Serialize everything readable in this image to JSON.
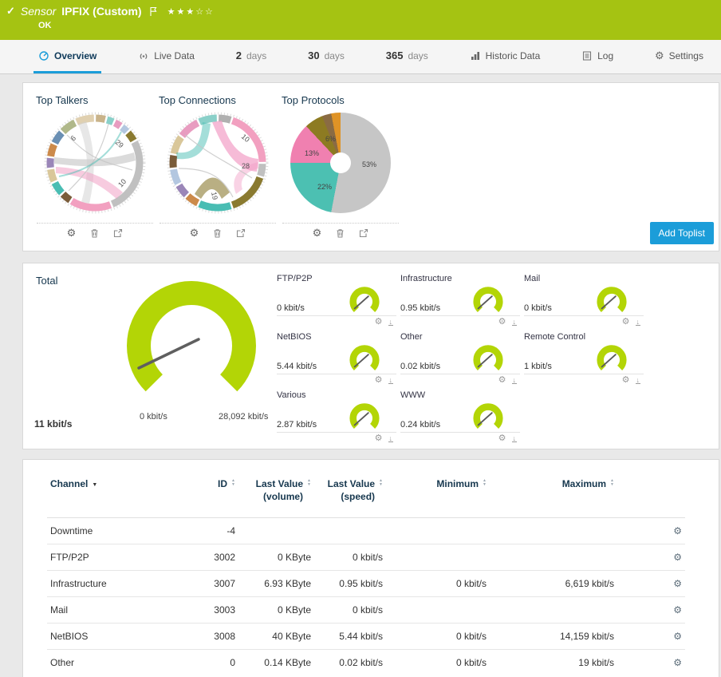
{
  "colors": {
    "header_green": "#a5c312",
    "gauge_green": "#b3d506",
    "accent_blue": "#1b9dd9",
    "header_navy": "#16374e"
  },
  "icons": {
    "check": "✓",
    "caret_down": "▼",
    "sort_up": "▲",
    "sort_down": "▼",
    "gear": "⚙",
    "download_arrow": "↓"
  },
  "header": {
    "kind_label": "Sensor",
    "sensor_name": "IPFIX (Custom)",
    "status": "OK",
    "stars": "★★★☆☆"
  },
  "tabs": [
    {
      "label": "Overview",
      "active": true
    },
    {
      "label": "Live Data"
    },
    {
      "num": "2",
      "label": "days"
    },
    {
      "num": "30",
      "label": "days"
    },
    {
      "num": "365",
      "label": "days"
    },
    {
      "label": "Historic Data"
    },
    {
      "label": "Log"
    },
    {
      "label": "Settings"
    }
  ],
  "toplists": {
    "add_button_label": "Add Toplist",
    "talkers": {
      "title": "Top Talkers",
      "segments": [
        [
          "#c9b38a",
          0.04
        ],
        [
          "#8ad0c9",
          0.03
        ],
        [
          "#e89cc0",
          0.03
        ],
        [
          "#b3c7e0",
          0.03
        ],
        [
          "#8a7a30",
          0.04
        ],
        [
          "#c0c0c0",
          0.27
        ],
        [
          "#f2a0c0",
          0.15
        ],
        [
          "#7a5c3a",
          0.04
        ],
        [
          "#49bdb3",
          0.05
        ],
        [
          "#d9c79a",
          0.05
        ],
        [
          "#9a86b8",
          0.04
        ],
        [
          "#cc8a4a",
          0.05
        ],
        [
          "#6a8fb3",
          0.05
        ],
        [
          "#b0b88a",
          0.06
        ],
        [
          "#e0d0b0",
          0.07
        ]
      ]
    },
    "connections": {
      "title": "Top Connections",
      "segments": [
        [
          "#b0b0b0",
          0.05
        ],
        [
          "#f2a0c0",
          0.2
        ],
        [
          "#c0c0c0",
          0.05
        ],
        [
          "#8a7a30",
          0.15
        ],
        [
          "#49bdb3",
          0.12
        ],
        [
          "#cc8a4a",
          0.05
        ],
        [
          "#9a86b8",
          0.05
        ],
        [
          "#b3c7e0",
          0.06
        ],
        [
          "#7a5c3a",
          0.05
        ],
        [
          "#d9c79a",
          0.07
        ],
        [
          "#e89cc0",
          0.08
        ],
        [
          "#8ad0c9",
          0.07
        ]
      ]
    },
    "protocols": {
      "title": "Top Protocols"
    }
  },
  "chart_data": [
    {
      "type": "pie",
      "title": "Top Protocols",
      "slices": [
        {
          "label": "53%",
          "value": 53,
          "color": "#c6c6c6"
        },
        {
          "label": "22%",
          "value": 22,
          "color": "#4cc0b2"
        },
        {
          "label": "13%",
          "value": 13,
          "color": "#f080b0"
        },
        {
          "label": "6%",
          "value": 6,
          "color": "#8d7b22"
        },
        {
          "label": "",
          "value": 3,
          "color": "#8a6b43"
        },
        {
          "label": "",
          "value": 3,
          "color": "#df9326"
        }
      ]
    },
    {
      "type": "chord",
      "title": "Top Talkers",
      "labels": [
        "6",
        "29",
        "10"
      ]
    },
    {
      "type": "chord",
      "title": "Top Connections",
      "labels": [
        "10",
        "28",
        "19"
      ]
    },
    {
      "type": "gauge",
      "title": "Total",
      "value": 11,
      "min": 0,
      "max": 28092,
      "unit": "kbit/s"
    }
  ],
  "gauges": {
    "total": {
      "label": "Total",
      "current": "11 kbit/s",
      "scale_min": "0 kbit/s",
      "scale_max": "28,092 kbit/s"
    },
    "channels": [
      {
        "name": "FTP/P2P",
        "value": "0 kbit/s"
      },
      {
        "name": "Infrastructure",
        "value": "0.95 kbit/s"
      },
      {
        "name": "Mail",
        "value": "0 kbit/s"
      },
      {
        "name": "NetBIOS",
        "value": "5.44 kbit/s"
      },
      {
        "name": "Other",
        "value": "0.02 kbit/s"
      },
      {
        "name": "Remote Control",
        "value": "1 kbit/s"
      },
      {
        "name": "Various",
        "value": "2.87 kbit/s"
      },
      {
        "name": "WWW",
        "value": "0.24 kbit/s"
      }
    ]
  },
  "table": {
    "columns": [
      {
        "label": "Channel"
      },
      {
        "label": "ID"
      },
      {
        "label": "Last Value",
        "sub": "(volume)"
      },
      {
        "label": "Last Value",
        "sub": "(speed)"
      },
      {
        "label": "Minimum"
      },
      {
        "label": "Maximum"
      }
    ],
    "rows": [
      {
        "channel": "Downtime",
        "id": "-4",
        "volume": "",
        "speed": "",
        "min": "",
        "max": ""
      },
      {
        "channel": "FTP/P2P",
        "id": "3002",
        "volume": "0 KByte",
        "speed": "0 kbit/s",
        "min": "",
        "max": ""
      },
      {
        "channel": "Infrastructure",
        "id": "3007",
        "volume": "6.93 KByte",
        "speed": "0.95 kbit/s",
        "min": "0 kbit/s",
        "max": "6,619 kbit/s"
      },
      {
        "channel": "Mail",
        "id": "3003",
        "volume": "0 KByte",
        "speed": "0 kbit/s",
        "min": "",
        "max": ""
      },
      {
        "channel": "NetBIOS",
        "id": "3008",
        "volume": "40 KByte",
        "speed": "5.44 kbit/s",
        "min": "0 kbit/s",
        "max": "14,159 kbit/s"
      },
      {
        "channel": "Other",
        "id": "0",
        "volume": "0.14 KByte",
        "speed": "0.02 kbit/s",
        "min": "0 kbit/s",
        "max": "19 kbit/s"
      }
    ]
  }
}
